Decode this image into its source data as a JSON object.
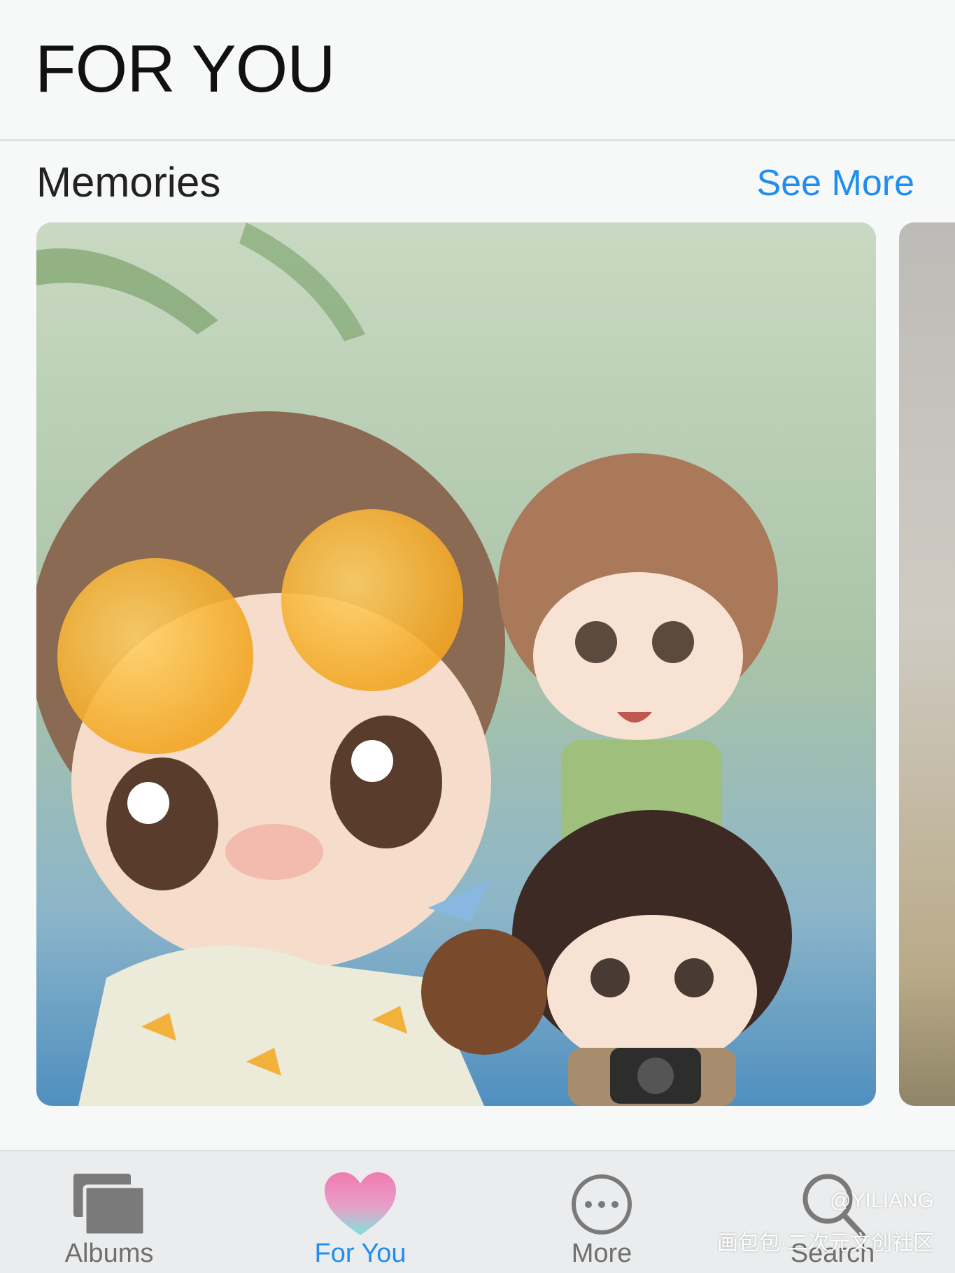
{
  "header": {
    "title": "FOR YOU"
  },
  "memories": {
    "section_title": "Memories",
    "see_more_label": "See More",
    "illustration": "chibi-beach-selfie-artwork"
  },
  "tab_bar": {
    "tabs": [
      {
        "label": "Albums",
        "icon": "albums-icon",
        "active": false
      },
      {
        "label": "For You",
        "icon": "heart-icon",
        "active": true
      },
      {
        "label": "More",
        "icon": "more-icon",
        "active": false
      },
      {
        "label": "Search",
        "icon": "search-icon",
        "active": false
      }
    ]
  },
  "watermark": {
    "handle": "@YILIANG",
    "site": "画包包·二次元文创社区"
  },
  "colors": {
    "accent": "#1f8ef0",
    "background": "#f7f8f8",
    "tab_bar": "#ebeced",
    "inactive": "#6f6f6f"
  }
}
